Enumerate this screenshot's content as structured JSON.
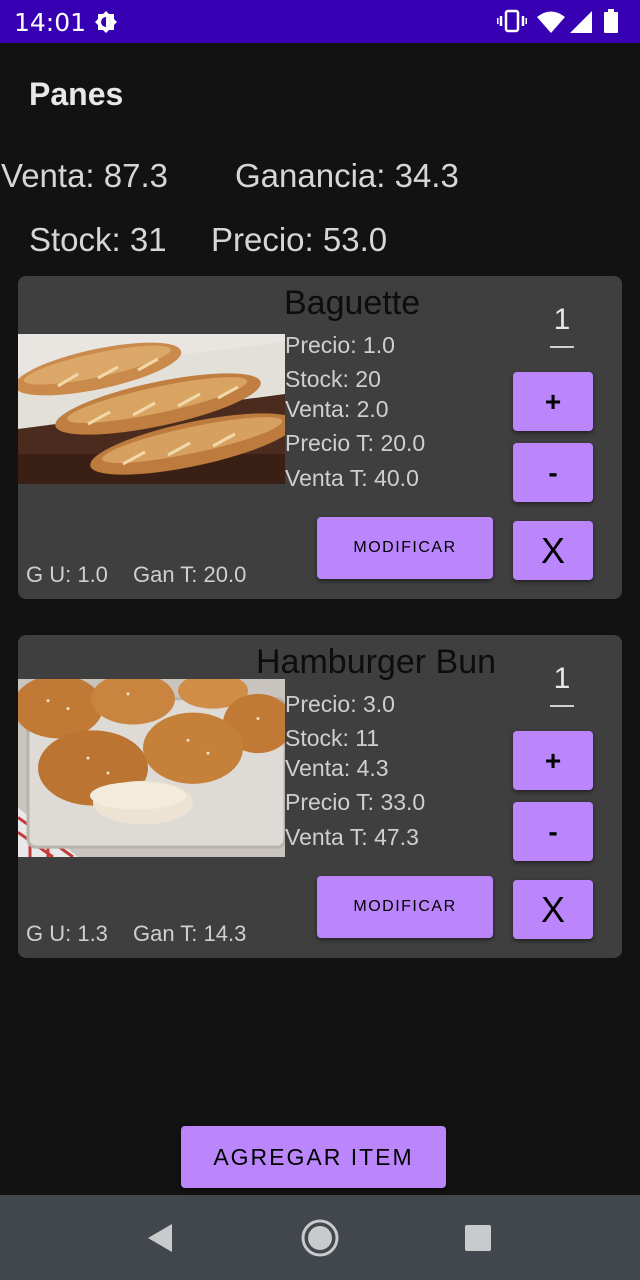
{
  "status_bar": {
    "time": "14:01",
    "icons": [
      "dnd-icon",
      "vibrate-icon",
      "wifi-icon",
      "signal-icon",
      "battery-icon"
    ]
  },
  "header": {
    "title": "Panes"
  },
  "summary": {
    "venta": "Venta: 87.3",
    "ganancia": "Ganancia: 34.3",
    "stock": "Stock: 31",
    "precio": "Precio: 53.0"
  },
  "items": [
    {
      "name": "Baguette",
      "image_label": "baguette-photo",
      "precio": "Precio: 1.0",
      "stock": "Stock: 20",
      "venta": "Venta: 2.0",
      "precio_t": "Precio T: 20.0",
      "venta_t": "Venta T: 40.0",
      "quantity": "1",
      "plus_label": "+",
      "minus_label": "-",
      "delete_label": "X",
      "modify_label": "MODIFICAR",
      "gu": "G U: 1.0",
      "gan_t": "Gan T: 20.0"
    },
    {
      "name": "Hamburger Bun",
      "image_label": "hamburger-bun-photo",
      "precio": "Precio: 3.0",
      "stock": "Stock: 11",
      "venta": "Venta: 4.3",
      "precio_t": "Precio T: 33.0",
      "venta_t": "Venta T: 47.3",
      "quantity": "1",
      "plus_label": "+",
      "minus_label": "-",
      "delete_label": "X",
      "modify_label": "MODIFICAR",
      "gu": "G U: 1.3",
      "gan_t": "Gan T: 14.3"
    }
  ],
  "add_button_label": "AGREGAR ITEM",
  "nav_bar": {
    "icons": [
      "back-icon",
      "home-icon",
      "recents-icon"
    ]
  },
  "colors": {
    "status_bar": "#3700b3",
    "background": "#121212",
    "card": "#3f3f3f",
    "button": "#bb86fc",
    "nav_bar": "#41474d"
  }
}
